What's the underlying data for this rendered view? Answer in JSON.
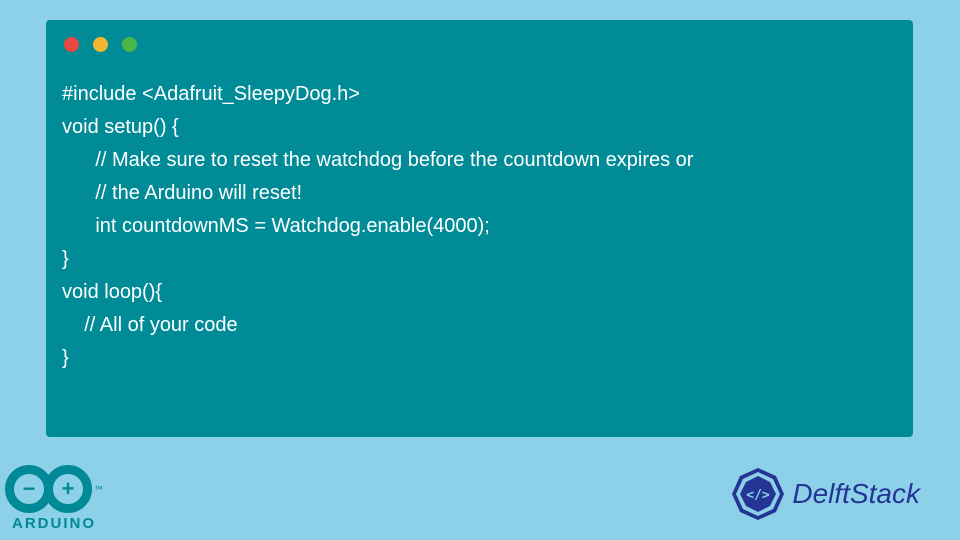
{
  "code": {
    "line1": "#include <Adafruit_SleepyDog.h>",
    "line2": "",
    "line3": "void setup() {",
    "line4": "      // Make sure to reset the watchdog before the countdown expires or",
    "line5": "      // the Arduino will reset!",
    "line6": "      int countdownMS = Watchdog.enable(4000);",
    "line7": "}",
    "line8": "void loop(){",
    "line9": "    // All of your code",
    "line10": "}"
  },
  "logos": {
    "arduino": "ARDUINO",
    "delftstack": "DelftStack",
    "minus": "−",
    "plus": "+"
  }
}
